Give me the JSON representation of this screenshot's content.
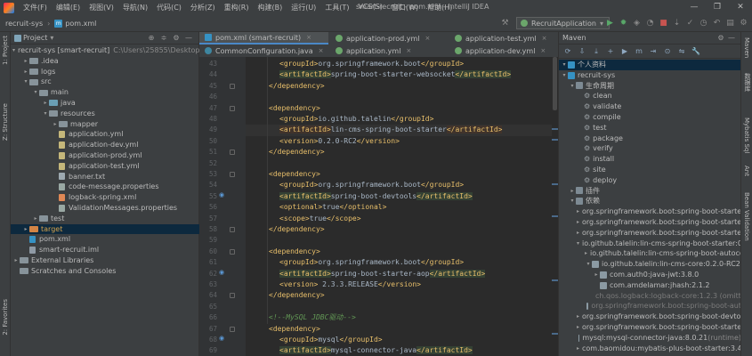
{
  "menubar": {
    "items": [
      "文件(F)",
      "编辑(E)",
      "视图(V)",
      "导航(N)",
      "代码(C)",
      "分析(Z)",
      "重构(R)",
      "构建(B)",
      "运行(U)",
      "工具(T)",
      "VCS(S)",
      "窗口(W)",
      "帮助(H)"
    ],
    "window_title": "smart-recruit - pom.xml - IntelliJ IDEA",
    "controls": [
      "—",
      "❐",
      "✕"
    ]
  },
  "navbar": {
    "project": "recruit-sys",
    "file": "pom.xml",
    "run_config": "RecruitApplication",
    "run_config_arrow": "▾"
  },
  "strips": {
    "left": [
      "1: Project",
      "Z: Structure",
      "2: Favorites"
    ],
    "right": [
      "Maven",
      "数据库",
      "Mybatis Sql",
      "Ant",
      "Bean Validation"
    ]
  },
  "project_panel": {
    "title": "Project",
    "title_arrow": "▾",
    "rows": [
      {
        "indent": 0,
        "arrow": "▾",
        "icon": "module",
        "name": "recruit-sys [smart-recruit]",
        "path": "C:\\Users\\25855\\Desktop\\招"
      },
      {
        "indent": 1,
        "arrow": "▸",
        "icon": "folder",
        "name": ".idea",
        "path": ""
      },
      {
        "indent": 1,
        "arrow": "▸",
        "icon": "folder",
        "name": "logs",
        "path": ""
      },
      {
        "indent": 1,
        "arrow": "▾",
        "icon": "folder",
        "name": "src",
        "path": ""
      },
      {
        "indent": 2,
        "arrow": "▾",
        "icon": "folder",
        "name": "main",
        "path": ""
      },
      {
        "indent": 3,
        "arrow": "▸",
        "icon": "blue",
        "name": "java",
        "path": ""
      },
      {
        "indent": 3,
        "arrow": "▾",
        "icon": "folder",
        "name": "resources",
        "path": ""
      },
      {
        "indent": 4,
        "arrow": "▸",
        "icon": "folder",
        "name": "mapper",
        "path": ""
      },
      {
        "indent": 4,
        "arrow": "",
        "icon": "yml",
        "name": "application.yml",
        "path": ""
      },
      {
        "indent": 4,
        "arrow": "",
        "icon": "yml",
        "name": "application-dev.yml",
        "path": ""
      },
      {
        "indent": 4,
        "arrow": "",
        "icon": "yml",
        "name": "application-prod.yml",
        "path": ""
      },
      {
        "indent": 4,
        "arrow": "",
        "icon": "yml",
        "name": "application-test.yml",
        "path": ""
      },
      {
        "indent": 4,
        "arrow": "",
        "icon": "file",
        "name": "banner.txt",
        "path": ""
      },
      {
        "indent": 4,
        "arrow": "",
        "icon": "prop",
        "name": "code-message.properties",
        "path": ""
      },
      {
        "indent": 4,
        "arrow": "",
        "icon": "xml",
        "name": "logback-spring.xml",
        "path": ""
      },
      {
        "indent": 4,
        "arrow": "",
        "icon": "prop",
        "name": "ValidationMessages.properties",
        "path": ""
      },
      {
        "indent": 2,
        "arrow": "▸",
        "icon": "folder",
        "name": "test",
        "path": ""
      },
      {
        "indent": 1,
        "arrow": "▸",
        "icon": "orange",
        "name": "target",
        "path": "",
        "selected": true,
        "orange": true
      },
      {
        "indent": 1,
        "arrow": "",
        "icon": "m",
        "name": "pom.xml",
        "path": ""
      },
      {
        "indent": 1,
        "arrow": "",
        "icon": "iml",
        "name": "smart-recruit.iml",
        "path": ""
      },
      {
        "indent": 0,
        "arrow": "▸",
        "icon": "lib",
        "name": "External Libraries",
        "path": ""
      },
      {
        "indent": 0,
        "arrow": "",
        "icon": "scratch",
        "name": "Scratches and Consoles",
        "path": ""
      }
    ]
  },
  "editor_tabs": {
    "row1": [
      {
        "icon": "m",
        "label": "pom.xml (smart-recruit)",
        "active": true
      },
      {
        "icon": "y",
        "label": "application-prod.yml",
        "active": false
      },
      {
        "icon": "y",
        "label": "application-test.yml",
        "active": false
      }
    ],
    "row2": [
      {
        "icon": "c",
        "label": "CommonConfiguration.java",
        "active": false
      },
      {
        "icon": "y",
        "label": "application.yml",
        "active": false
      },
      {
        "icon": "y",
        "label": "application-dev.yml",
        "active": false
      }
    ],
    "close_glyph": "×"
  },
  "editor": {
    "lines": [
      {
        "n": "43",
        "indent": 3,
        "parts": [
          [
            "tg",
            "<groupId>"
          ],
          [
            "tx",
            "org.springframework.boot"
          ],
          [
            "tg",
            "</groupId>"
          ]
        ]
      },
      {
        "n": "44",
        "indent": 3,
        "parts": [
          [
            "tg",
            "<artifactId>"
          ],
          [
            "tx",
            "spring-boot-starter-websocket"
          ],
          [
            "tg",
            "</artifactId>"
          ]
        ]
      },
      {
        "n": "45",
        "indent": 2,
        "parts": [
          [
            "tg",
            "</dependency>"
          ]
        ]
      },
      {
        "n": "46",
        "indent": 0,
        "parts": []
      },
      {
        "n": "47",
        "indent": 2,
        "parts": [
          [
            "tg",
            "<dependency>"
          ]
        ]
      },
      {
        "n": "48",
        "indent": 3,
        "parts": [
          [
            "tg",
            "<groupId>"
          ],
          [
            "tx",
            "io.github.talelin"
          ],
          [
            "tg",
            "</groupId>"
          ]
        ]
      },
      {
        "n": "49",
        "indent": 3,
        "current": true,
        "parts": [
          [
            "tg",
            "<artifactId>"
          ],
          [
            "tx",
            "lin-cms-spring-boot-starter"
          ],
          [
            "tg",
            "</artifactId>"
          ]
        ]
      },
      {
        "n": "50",
        "indent": 3,
        "parts": [
          [
            "tg",
            "<version>"
          ],
          [
            "tx",
            "0.2.0-RC2"
          ],
          [
            "tg",
            "</version>"
          ]
        ]
      },
      {
        "n": "51",
        "indent": 2,
        "parts": [
          [
            "tg",
            "</dependency>"
          ]
        ]
      },
      {
        "n": "52",
        "indent": 0,
        "parts": []
      },
      {
        "n": "53",
        "indent": 2,
        "parts": [
          [
            "tg",
            "<dependency>"
          ]
        ]
      },
      {
        "n": "54",
        "indent": 3,
        "parts": [
          [
            "tg",
            "<groupId>"
          ],
          [
            "tx",
            "org.springframework.boot"
          ],
          [
            "tg",
            "</groupId>"
          ]
        ]
      },
      {
        "n": "55",
        "indent": 3,
        "parts": [
          [
            "tg",
            "<artifactId>"
          ],
          [
            "tx",
            "spring-boot-devtools"
          ],
          [
            "tg",
            "</artifactId>"
          ]
        ]
      },
      {
        "n": "56",
        "indent": 3,
        "parts": [
          [
            "tg",
            "<optional>"
          ],
          [
            "tx",
            "true"
          ],
          [
            "tg",
            "</optional>"
          ]
        ]
      },
      {
        "n": "57",
        "indent": 3,
        "parts": [
          [
            "tg",
            "<scope>"
          ],
          [
            "tx",
            "true"
          ],
          [
            "tg",
            "</scope>"
          ]
        ]
      },
      {
        "n": "58",
        "indent": 2,
        "parts": [
          [
            "tg",
            "</dependency>"
          ]
        ]
      },
      {
        "n": "59",
        "indent": 0,
        "parts": []
      },
      {
        "n": "60",
        "indent": 2,
        "parts": [
          [
            "tg",
            "<dependency>"
          ]
        ]
      },
      {
        "n": "61",
        "indent": 3,
        "parts": [
          [
            "tg",
            "<groupId>"
          ],
          [
            "tx",
            "org.springframework.boot"
          ],
          [
            "tg",
            "</groupId>"
          ]
        ]
      },
      {
        "n": "62",
        "indent": 3,
        "parts": [
          [
            "tg",
            "<artifactId>"
          ],
          [
            "tx",
            "spring-boot-starter-aop"
          ],
          [
            "tg",
            "</artifactId>"
          ]
        ]
      },
      {
        "n": "63",
        "indent": 3,
        "parts": [
          [
            "tg",
            "<version>"
          ],
          [
            "tx",
            " 2.3.3.RELEASE"
          ],
          [
            "tg",
            "</version>"
          ]
        ]
      },
      {
        "n": "64",
        "indent": 2,
        "parts": [
          [
            "tg",
            "</dependency>"
          ]
        ]
      },
      {
        "n": "65",
        "indent": 0,
        "parts": []
      },
      {
        "n": "66",
        "indent": 2,
        "parts": [
          [
            "cm",
            "<!--MySQL JDBC驱动-->"
          ]
        ]
      },
      {
        "n": "67",
        "indent": 2,
        "parts": [
          [
            "tg",
            "<dependency>"
          ]
        ]
      },
      {
        "n": "68",
        "indent": 3,
        "parts": [
          [
            "tg",
            "<groupId>"
          ],
          [
            "tx",
            "mysql"
          ],
          [
            "tg",
            "</groupId>"
          ]
        ]
      },
      {
        "n": "69",
        "indent": 3,
        "parts": [
          [
            "tg",
            "<artifactId>"
          ],
          [
            "tx",
            "mysql-connector-java"
          ],
          [
            "tg",
            "</artifactId>"
          ]
        ]
      }
    ]
  },
  "maven_panel": {
    "title": "Maven",
    "toolbar": [
      "⟳",
      "⇩",
      "⤓",
      "+",
      "▶",
      "m",
      "⇥",
      "⊙",
      "⇋",
      "🔧"
    ],
    "rows": [
      {
        "indent": 0,
        "arrow": "▾",
        "icon": "m",
        "text": "个人资料",
        "selected": true
      },
      {
        "indent": 0,
        "arrow": "▾",
        "icon": "m",
        "text": "recruit-sys"
      },
      {
        "indent": 1,
        "arrow": "▾",
        "icon": "folder",
        "text": "生命周期"
      },
      {
        "indent": 2,
        "arrow": "",
        "icon": "gear",
        "text": "clean"
      },
      {
        "indent": 2,
        "arrow": "",
        "icon": "gear",
        "text": "validate"
      },
      {
        "indent": 2,
        "arrow": "",
        "icon": "gear",
        "text": "compile"
      },
      {
        "indent": 2,
        "arrow": "",
        "icon": "gear",
        "text": "test"
      },
      {
        "indent": 2,
        "arrow": "",
        "icon": "gear",
        "text": "package"
      },
      {
        "indent": 2,
        "arrow": "",
        "icon": "gear",
        "text": "verify"
      },
      {
        "indent": 2,
        "arrow": "",
        "icon": "gear",
        "text": "install"
      },
      {
        "indent": 2,
        "arrow": "",
        "icon": "gear",
        "text": "site"
      },
      {
        "indent": 2,
        "arrow": "",
        "icon": "gear",
        "text": "deploy"
      },
      {
        "indent": 1,
        "arrow": "▸",
        "icon": "folder",
        "text": "插件"
      },
      {
        "indent": 1,
        "arrow": "▾",
        "icon": "folder",
        "text": "依赖"
      },
      {
        "indent": 2,
        "arrow": "▸",
        "icon": "lib",
        "text": "org.springframework.boot:spring-boot-starter:2."
      },
      {
        "indent": 2,
        "arrow": "▸",
        "icon": "lib",
        "text": "org.springframework.boot:spring-boot-starter-w"
      },
      {
        "indent": 2,
        "arrow": "▸",
        "icon": "lib",
        "text": "org.springframework.boot:spring-boot-starter-w"
      },
      {
        "indent": 2,
        "arrow": "▾",
        "icon": "lib",
        "text": "io.github.talelin:lin-cms-spring-boot-starter:0.2.0"
      },
      {
        "indent": 3,
        "arrow": "▸",
        "icon": "lib",
        "text": "io.github.talelin:lin-cms-spring-boot-autocon"
      },
      {
        "indent": 3,
        "arrow": "▾",
        "icon": "lib",
        "text": "io.github.talelin:lin-cms-core:0.2.0-RC2"
      },
      {
        "indent": 4,
        "arrow": "▸",
        "icon": "lib",
        "text": "com.auth0:java-jwt:3.8.0"
      },
      {
        "indent": 4,
        "arrow": "",
        "icon": "lib",
        "text": "com.amdelamar:jhash:2.1.2"
      },
      {
        "indent": 4,
        "arrow": "",
        "icon": "lib",
        "text": "ch.qos.logback:logback-core:1.2.3 (omitted",
        "dim": true
      },
      {
        "indent": 3,
        "arrow": "",
        "icon": "lib",
        "text": "org.springframework.boot:spring-boot-aut",
        "dim": true
      },
      {
        "indent": 2,
        "arrow": "▸",
        "icon": "lib",
        "text": "org.springframework.boot:spring-boot-devtools:"
      },
      {
        "indent": 2,
        "arrow": "▸",
        "icon": "lib",
        "text": "org.springframework.boot:spring-boot-starter-a"
      },
      {
        "indent": 2,
        "arrow": "",
        "icon": "lib",
        "text": "mysql:mysql-connector-java:8.0.21",
        "suffix": " (runtime)"
      },
      {
        "indent": 2,
        "arrow": "▸",
        "icon": "lib",
        "text": "com.baomidou:mybatis-plus-boot-starter:3.4.0"
      }
    ]
  }
}
